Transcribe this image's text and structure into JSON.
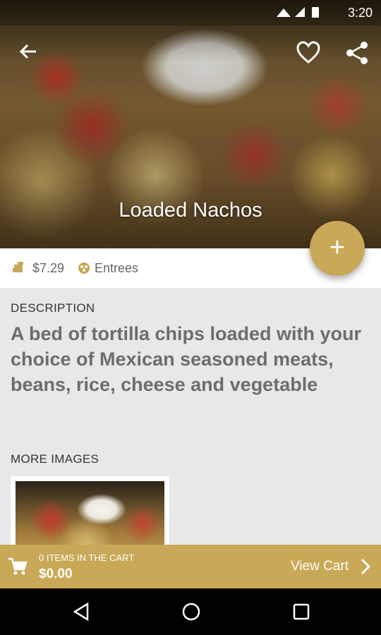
{
  "status_bar": {
    "time": "3:20"
  },
  "header": {
    "title": "Loaded Nachos"
  },
  "fab": {
    "label": "+"
  },
  "info": {
    "price": "$7.29",
    "category": "Entrees"
  },
  "description": {
    "heading": "DESCRIPTION",
    "text": "A bed of tortilla chips loaded with your choice of Mexican seasoned meats, beans, rice, cheese and vegetable"
  },
  "more_images": {
    "heading": "MORE IMAGES"
  },
  "cart": {
    "count_label": "0 ITEMS IN THE CART",
    "total": "$0.00",
    "view_label": "View Cart"
  },
  "colors": {
    "accent": "#c9a857"
  },
  "icons": [
    "back-arrow-icon",
    "heart-icon",
    "share-icon",
    "price-tag-icon",
    "category-icon",
    "cart-icon",
    "chevron-right-icon"
  ]
}
